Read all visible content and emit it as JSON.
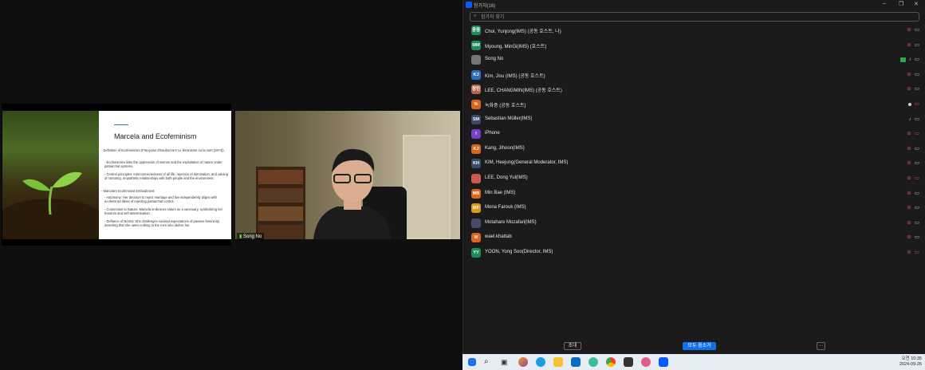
{
  "window": {
    "title": "참가자(16)"
  },
  "share": {
    "slide_title": "Marcela and Ecofeminism",
    "bullets": [
      "- Definition of Ecofeminism (Françoise d'Eaubonne's Le féminisme ou la mort [1974]). .",
      "- Ecofeminism links the oppression of women and the exploitation of nature under patriarchal systems.",
      "- Central principles: Interconnectedness of all life, rejection of domination, and valuing of nurturing, empathetic relationships with both people and the environment.",
      "- Marcela's Ecofeminist Embodiment:",
      "- Autonomy: Her decision to reject marriage and live independently aligns with ecofeminist ideas of rejecting patriarchal control.",
      "- Connection to Nature: Marcela embraces nature as a sanctuary, symbolizing her freedom and self-determination.",
      "- Defiance of Norms: She challenges societal expectations of passive femininity, asserting that she owes nothing to the men who idolize her."
    ]
  },
  "video": {
    "name": "Song No"
  },
  "search": {
    "placeholder": "참가자 찾기"
  },
  "participants": [
    {
      "initials": "윤중",
      "name": "Choi, Yunjong(IMS) (공동 호스트, 나)",
      "color": "#1f8a5b",
      "mic": "muted",
      "cam": "off"
    },
    {
      "initials": "MM",
      "name": "Myoung, MinGi(IMS) (호스트)",
      "color": "#1f8a5b",
      "mic": "muted",
      "cam": "off"
    },
    {
      "initials": "",
      "name": "Song No",
      "color": "#777777",
      "mic": "on",
      "cam": "off",
      "badge": true
    },
    {
      "initials": "KJ",
      "name": "Kim, Jisu (IMS) (공동 호스트)",
      "color": "#2f6fbf",
      "mic": "muted",
      "cam": "off"
    },
    {
      "initials": "창민",
      "name": "LEE, CHANGMIN(IMS) (공동 호스트)",
      "color": "#b0664a",
      "mic": "muted",
      "cam": "off"
    },
    {
      "initials": "%",
      "name": "녹화중 (공동 호스트)",
      "color": "#d9661b",
      "mic": "dot",
      "cam": "muted"
    },
    {
      "initials": "SM",
      "name": "Sebastian Müller(IMS)",
      "color": "#3a4a6a",
      "mic": "on",
      "cam": "off"
    },
    {
      "initials": "I",
      "name": "iPhone",
      "color": "#7b3fc4",
      "mic": "muted",
      "cam": "muted"
    },
    {
      "initials": "KJ",
      "name": "Kang, Jihoon(IMS)",
      "color": "#d9661b",
      "mic": "muted",
      "cam": "off"
    },
    {
      "initials": "KH",
      "name": "KIM, Heejung(General Moderator, IMS)",
      "color": "#3a4a6a",
      "mic": "muted",
      "cam": "off"
    },
    {
      "initials": "",
      "name": "LEE, Dong Yul(IMS)",
      "color": "#c95b4a",
      "mic": "muted",
      "cam": "muted"
    },
    {
      "initials": "MB",
      "name": "Min Bae (IMS)",
      "color": "#d9661b",
      "mic": "muted",
      "cam": "off"
    },
    {
      "initials": "MF",
      "name": "Mona Farouk (IMS)",
      "color": "#d99a1b",
      "mic": "muted",
      "cam": "off"
    },
    {
      "initials": "",
      "name": "Motahare Mozafari(IMS)",
      "color": "#4a4a6a",
      "mic": "muted",
      "cam": "off"
    },
    {
      "initials": "W",
      "name": "wael.khattab",
      "color": "#d9661b",
      "mic": "muted",
      "cam": "off"
    },
    {
      "initials": "YY",
      "name": "YOON, Yong Soo(Director, IMS)",
      "color": "#1f8a5b",
      "mic": "muted",
      "cam": "muted"
    }
  ],
  "footer": {
    "invite": "초대",
    "mute_all": "모두 음소거",
    "more": "···"
  },
  "taskbar": {
    "time": "오전 10:35",
    "date": "2024-09-26"
  }
}
